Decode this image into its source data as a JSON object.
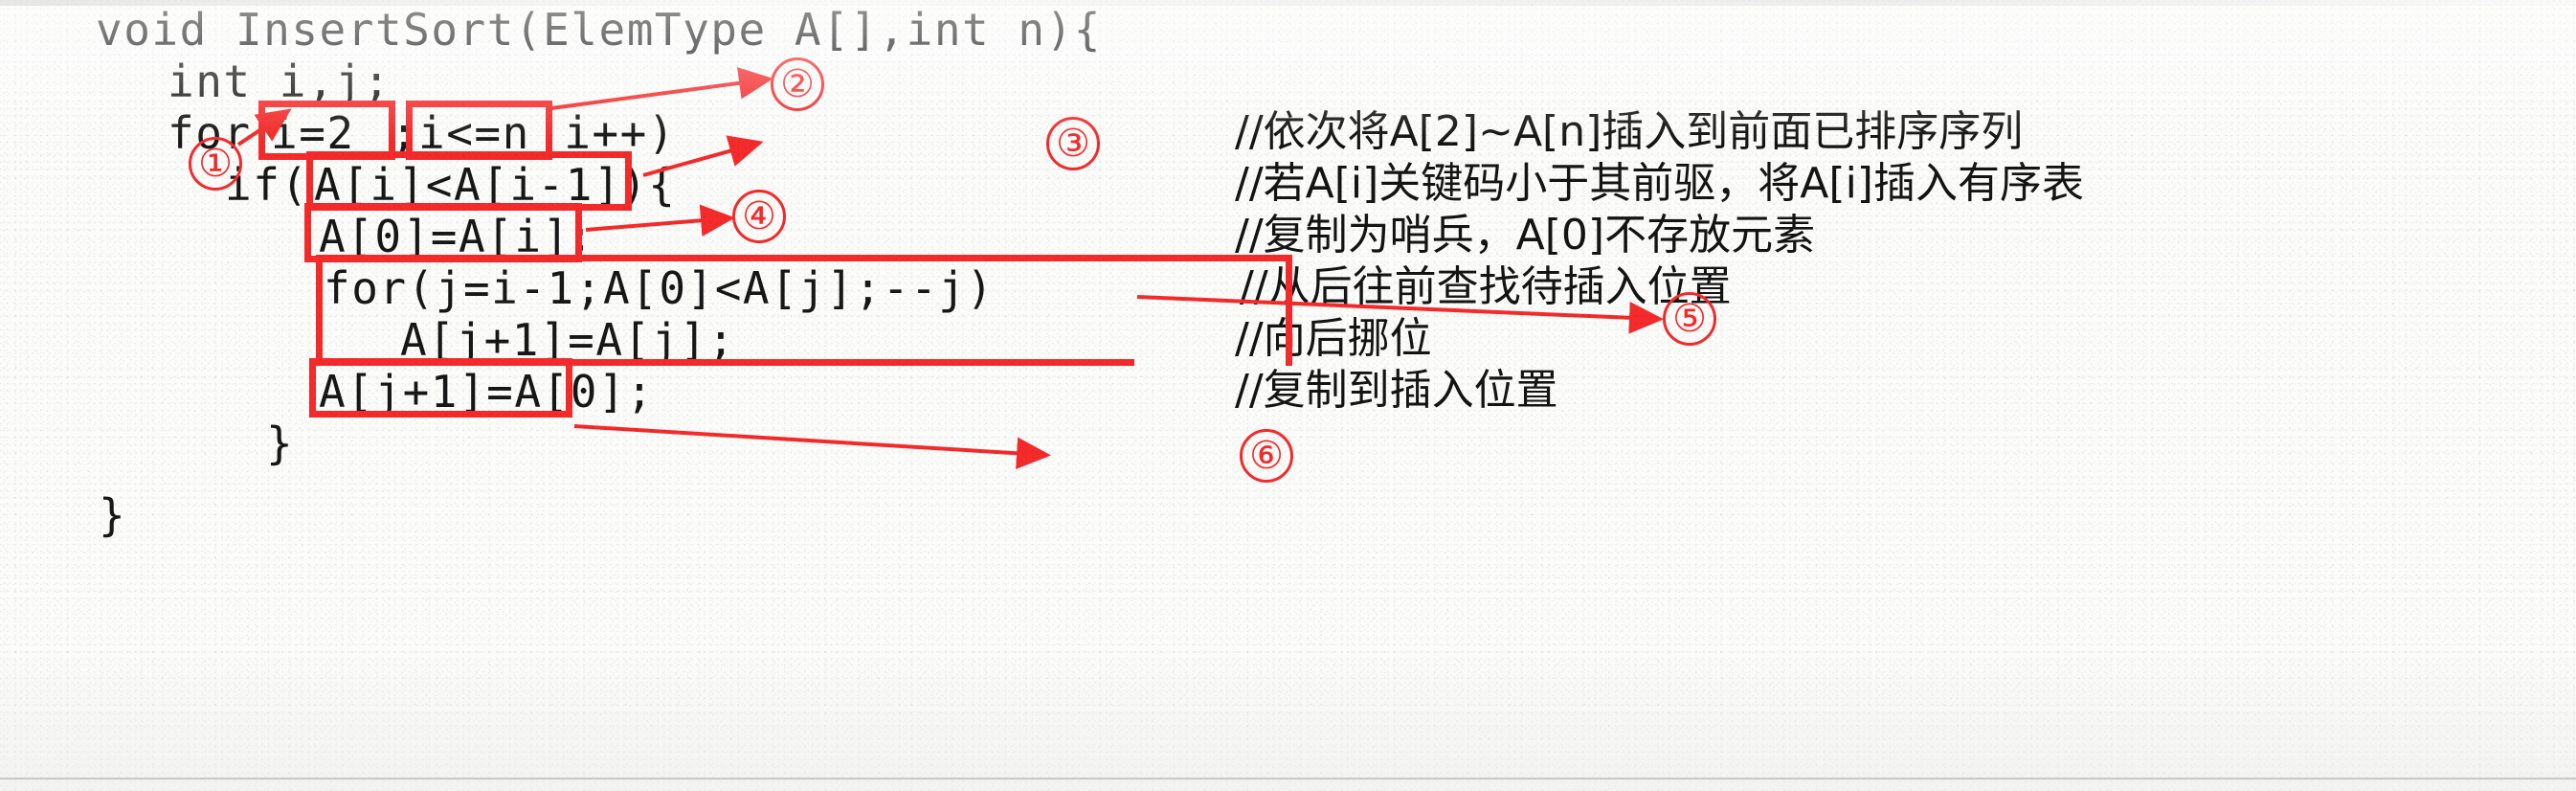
{
  "document": {
    "kind": "scanned-code-annotation",
    "language": "C",
    "function_name": "InsertSort",
    "accent_color": "#f52a2a",
    "text_color": "#171717",
    "paper_color": "#fbfbfa"
  },
  "code_lines": [
    {
      "id": "line-1",
      "text": "void InsertSort(ElemType A[],int n){"
    },
    {
      "id": "line-2",
      "text": "int i,j;"
    },
    {
      "id": "line-3",
      "text": "for (i=2;i<=n;i++)"
    },
    {
      "id": "line-4",
      "text": "if(A[i]<A[i-1]){"
    },
    {
      "id": "line-5",
      "text": "A[0]=A[i];"
    },
    {
      "id": "line-6",
      "text": "for(j=i-1;A[0]<A[j];--j)"
    },
    {
      "id": "line-7",
      "text": "A[j+1]=A[j];"
    },
    {
      "id": "line-8",
      "text": "A[j+1]=A[0];"
    },
    {
      "id": "line-9",
      "text": "}"
    },
    {
      "id": "line-10",
      "text": "}"
    }
  ],
  "code_segments": {
    "l3_for": "for ",
    "l3_init": "i=2",
    "l3_semi1": ";",
    "l3_cond": "i<=n",
    "l3_rest": ";i++)",
    "l4_if": "if(",
    "l4_expr": "A[i]<A[i-1]",
    "l4_rest": "){",
    "l5_expr": "A[0]=A[i]",
    "l5_semi": ";",
    "l6_text": "for(j=i-1;A[0]<A[j];--j)",
    "l7_text": "A[j+1]=A[j];",
    "l8_expr": "A[j+1]=A[0];",
    "l9_text": "}",
    "l10_text": "}"
  },
  "comments": [
    {
      "id": "comment-1",
      "text": "//依次将A[2]~A[n]插入到前面已排序序列"
    },
    {
      "id": "comment-2",
      "text": "//若A[i]关键码小于其前驱，将A[i]插入有序表"
    },
    {
      "id": "comment-3",
      "text": "//复制为哨兵，A[0]不存放元素"
    },
    {
      "id": "comment-4",
      "text": "//从后往前查找待插入位置"
    },
    {
      "id": "comment-5",
      "text": "//向后挪位"
    },
    {
      "id": "comment-6",
      "text": "//复制到插入位置"
    }
  ],
  "markers": [
    {
      "id": "marker-1",
      "label": "①",
      "target": "i=2"
    },
    {
      "id": "marker-2",
      "label": "②",
      "target": "i<=n"
    },
    {
      "id": "marker-3",
      "label": "③",
      "target": "A[i]<A[i-1]"
    },
    {
      "id": "marker-4",
      "label": "④",
      "target": "A[0]=A[i]"
    },
    {
      "id": "marker-5",
      "label": "⑤",
      "target": "for(j=i-1;A[0]<A[j];--j) A[j+1]=A[j];"
    },
    {
      "id": "marker-6",
      "label": "⑥",
      "target": "A[j+1]=A[0];"
    }
  ]
}
